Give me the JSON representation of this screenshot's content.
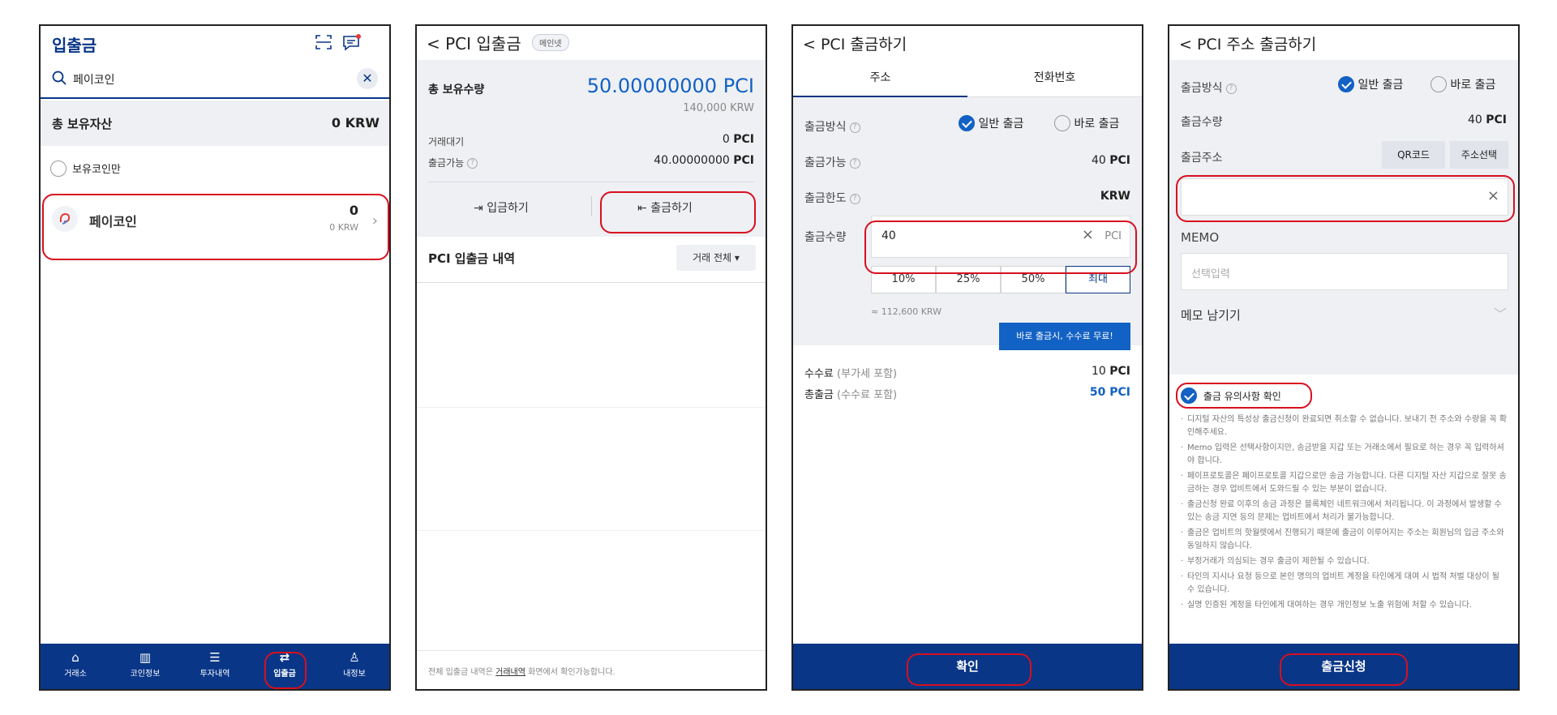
{
  "screen1": {
    "title": "입출금",
    "search_value": "페이코인",
    "total_label": "총 보유자산",
    "total_value": "0 KRW",
    "filter_label": "보유코인만",
    "coin": {
      "name": "페이코인",
      "amount": "0",
      "krw": "0 KRW"
    },
    "tabs": [
      {
        "label": "거래소",
        "icon": "home-icon"
      },
      {
        "label": "코인정보",
        "icon": "chart-icon"
      },
      {
        "label": "투자내역",
        "icon": "document-icon"
      },
      {
        "label": "입출금",
        "icon": "transfer-icon"
      },
      {
        "label": "내정보",
        "icon": "person-icon"
      }
    ]
  },
  "screen2": {
    "back_label": "<",
    "title": "PCI 입출금",
    "badge": "메인넷",
    "holding_label": "총 보유수량",
    "holding_value": "50.00000000 PCI",
    "holding_krw": "140,000 KRW",
    "pending_label": "거래대기",
    "pending_value": "0",
    "pending_unit": "PCI",
    "available_label": "출금가능",
    "available_value": "40.00000000",
    "available_unit": "PCI",
    "deposit_label": "입금하기",
    "withdraw_label": "출금하기",
    "history_label": "PCI 입출금 내역",
    "history_filter": "거래 전체",
    "footer_prefix": "전체 입출금 내역은",
    "footer_link": "거래내역",
    "footer_suffix": "화면에서 확인가능합니다."
  },
  "screen3": {
    "title": "PCI 출금하기",
    "tab_address": "주소",
    "tab_phone": "전화번호",
    "method_label": "출금방식",
    "method_normal": "일반 출금",
    "method_direct": "바로 출금",
    "available_label": "출금가능",
    "available_value": "40",
    "available_unit": "PCI",
    "limit_label": "출금한도",
    "limit_value": "KRW",
    "qty_label": "출금수량",
    "qty_value": "40",
    "qty_unit": "PCI",
    "pct": [
      "10%",
      "25%",
      "50%",
      "최대"
    ],
    "krw_estimate": "≈ 112,600 KRW",
    "tooltip": "바로 출금시, 수수료 무료!",
    "fee_label": "수수료",
    "fee_note": "(부가세 포함)",
    "fee_value": "10",
    "fee_unit": "PCI",
    "total_label": "총출금",
    "total_note": "(수수료 포함)",
    "total_value": "50",
    "total_unit": "PCI",
    "confirm_label": "확인"
  },
  "screen4": {
    "title": "PCI 주소 출금하기",
    "method_label": "출금방식",
    "method_normal": "일반 출금",
    "method_direct": "바로 출금",
    "qty_label": "출금수량",
    "qty_value": "40",
    "qty_unit": "PCI",
    "address_label": "출금주소",
    "qr_label": "QR코드",
    "select_label": "주소선택",
    "address_placeholder": "",
    "memo_label": "MEMO",
    "memo_placeholder": "선택입력",
    "note_label": "메모 남기기",
    "notice_check": "출금 유의사항 확인",
    "notices": [
      "디지털 자산의 특성상 출금신청이 완료되면 취소할 수 없습니다. 보내기 전 주소와 수량을 꼭 확인해주세요.",
      "Memo 입력은 선택사항이지만, 송금받을 지갑 또는 거래소에서 필요로 하는 경우 꼭 입력하셔야 합니다.",
      "페이프로토콜은 페이프로토콜 지갑으로만 송금 가능합니다. 다른 디지털 자산 지갑으로 잘못 송금하는 경우 업비트에서 도와드릴 수 있는 부분이 없습니다.",
      "출금신청 완료 이후의 송금 과정은 블록체인 네트워크에서 처리됩니다. 이 과정에서 발생할 수 있는 송금 지연 등의 문제는 업비트에서 처리가 불가능합니다.",
      "출금은 업비트의 핫월렛에서 진행되기 때문에 출금이 이루어지는 주소는 회원님의 입금 주소와 동일하지 않습니다.",
      "부정거래가 의심되는 경우 출금이 제한될 수 있습니다.",
      "타인의 지시나 요청 등으로 본인 명의의 업비트 계정을 타인에게 대여 시 법적 처벌 대상이 될 수 있습니다.",
      "실명 인증된 계정을 타인에게 대여하는 경우 개인정보 노출 위험에 처할 수 있습니다."
    ],
    "submit_label": "출금신청"
  },
  "colors": {
    "navy": "#093687",
    "blue": "#1261c4",
    "highlight": "#d80f1f",
    "panel_gray": "#eef0f3"
  }
}
